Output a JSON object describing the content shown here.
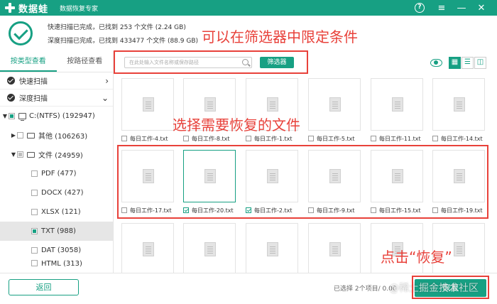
{
  "titlebar": {
    "app_name": "数据蛙",
    "app_subtitle": "数据恢复专家",
    "help_glyph": "?",
    "menu_glyph": "≡",
    "minimize_glyph": "—",
    "close_glyph": "✕"
  },
  "status": {
    "quick_scan": "快速扫描已完成，已找到 253 个文件 (2.24 GB)",
    "deep_scan": "深度扫描已完成，已找到 433477 个文件 (88.9 GB)"
  },
  "annotations": {
    "filter_hint": "可以在筛选器中限定条件",
    "select_hint": "选择需要恢复的文件",
    "click_hint": "点击“恢复”"
  },
  "tabs": [
    "按类型查看",
    "按路径查看"
  ],
  "sidebar": {
    "quick_scan": "快速扫描",
    "deep_scan": "深度扫描",
    "drive": "C:(NTFS) (192947)",
    "folder_other": "其他 (106263)",
    "folder_docs": "文件 (24959)",
    "types": [
      "PDF (477)",
      "DOCX (427)",
      "XLSX (121)",
      "TXT (988)",
      "DAT (3058)",
      "HTML (313)"
    ]
  },
  "toolbar": {
    "search_placeholder": "在此处输入文件名称或保存路径",
    "filter_label": "筛选器",
    "grid_view_glyph": "▦",
    "list_view_glyph": "☰",
    "detail_view_glyph": "◫"
  },
  "files": {
    "row1": [
      "每日工作-4.txt",
      "每日工作-8.txt",
      "每日工作-1.txt",
      "每日工作-5.txt",
      "每日工作-11.txt",
      "每日工作-14.txt"
    ],
    "row2": [
      "每日工作-17.txt",
      "每日工作-20.txt",
      "每日工作-2.txt",
      "每日工作-9.txt",
      "每日工作-15.txt",
      "每日工作-19.txt"
    ]
  },
  "bottom": {
    "back_label": "返回",
    "selected_info": "已选择 2个项目/ 0.00",
    "recover_label": "恢复",
    "watermark": "@稀土掘金技术社区"
  },
  "colors": {
    "accent": "#17a083",
    "annotation": "#e8413a"
  }
}
